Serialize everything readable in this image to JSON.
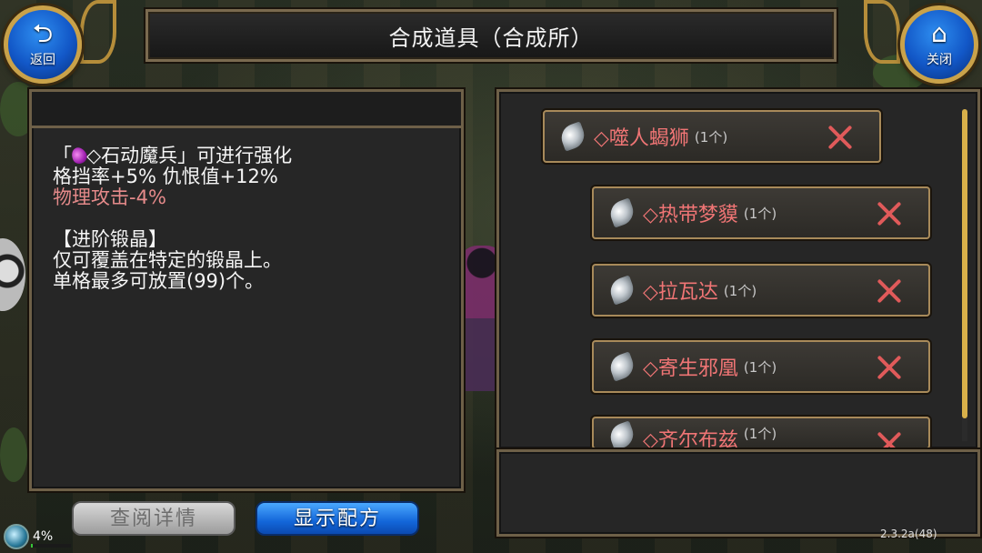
{
  "header": {
    "title": "合成道具（合成所）"
  },
  "nav": {
    "back": {
      "icon": "back-arrow-icon",
      "label": "返回"
    },
    "close": {
      "icon": "home-icon",
      "label": "关闭"
    }
  },
  "description": {
    "line1_prefix": "「",
    "line1_item": "◇石动魔兵",
    "line1_suffix": "」可进行强化",
    "line2": "格挡率+5% 仇恨值+12%",
    "line3": "物理攻击-4%",
    "line4": "【进阶锻晶】",
    "line5": "仅可覆盖在特定的锻晶上。",
    "line6": "单格最多可放置(99)个。"
  },
  "materials": [
    {
      "name": "◇噬人蝎狮",
      "count": "(1个)"
    },
    {
      "name": "◇热带梦貘",
      "count": "(1个)"
    },
    {
      "name": "◇拉瓦达",
      "count": "(1个)"
    },
    {
      "name": "◇寄生邪凰",
      "count": "(1个)"
    },
    {
      "name": "◇齐尔布兹",
      "count": "(1个)"
    }
  ],
  "buttons": {
    "details": "查阅详情",
    "recipe": "显示配方"
  },
  "status": {
    "percent": "4%",
    "progress": 0.04
  },
  "version": "2.3.2a(48)",
  "colors": {
    "accent": "#1366d9",
    "negative": "#e58a8a",
    "item_name": "#f07575",
    "frame": "#a88a5a"
  }
}
